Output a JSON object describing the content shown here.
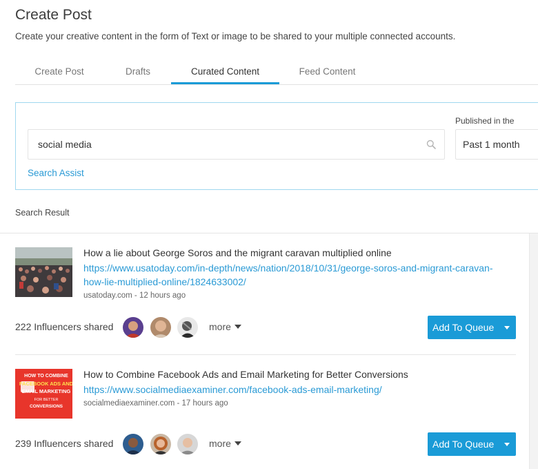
{
  "header": {
    "title": "Create Post",
    "subtitle": "Create your creative content in the form of Text or image to be shared to your multiple connected accounts."
  },
  "tabs": [
    {
      "label": "Create Post",
      "active": false
    },
    {
      "label": "Drafts",
      "active": false
    },
    {
      "label": "Curated Content",
      "active": true
    },
    {
      "label": "Feed Content",
      "active": false
    }
  ],
  "search": {
    "value": "social media",
    "published_label": "Published in the",
    "published_value": "Past 1 month",
    "assist_label": "Search Assist"
  },
  "results_label": "Search Result",
  "results": [
    {
      "title": "How a lie about George Soros and the migrant caravan multiplied online",
      "link": "https://www.usatoday.com/in-depth/news/nation/2018/10/31/george-soros-and-migrant-caravan-how-lie-multiplied-online/1824633002/",
      "meta": "usatoday.com - 12 hours ago",
      "influencer_count": "222",
      "influencer_label": "Influencers shared",
      "more_label": "more",
      "button_label": "Add To Queue"
    },
    {
      "title": "How to Combine Facebook Ads and Email Marketing for Better Conversions",
      "link": "https://www.socialmediaexaminer.com/facebook-ads-email-marketing/",
      "meta": "socialmediaexaminer.com - 17 hours ago",
      "influencer_count": "239",
      "influencer_label": "Influencers shared",
      "more_label": "more",
      "button_label": "Add To Queue",
      "thumb_text": "HOW TO COMBINE FACEBOOK ADS AND EMAIL MARKETING FOR BETTER CONVERSIONS"
    }
  ],
  "colors": {
    "accent": "#1a9bd7",
    "link": "#2a9ad5",
    "panel_border": "#9fd8ef",
    "thumb_red": "#e8352b"
  }
}
